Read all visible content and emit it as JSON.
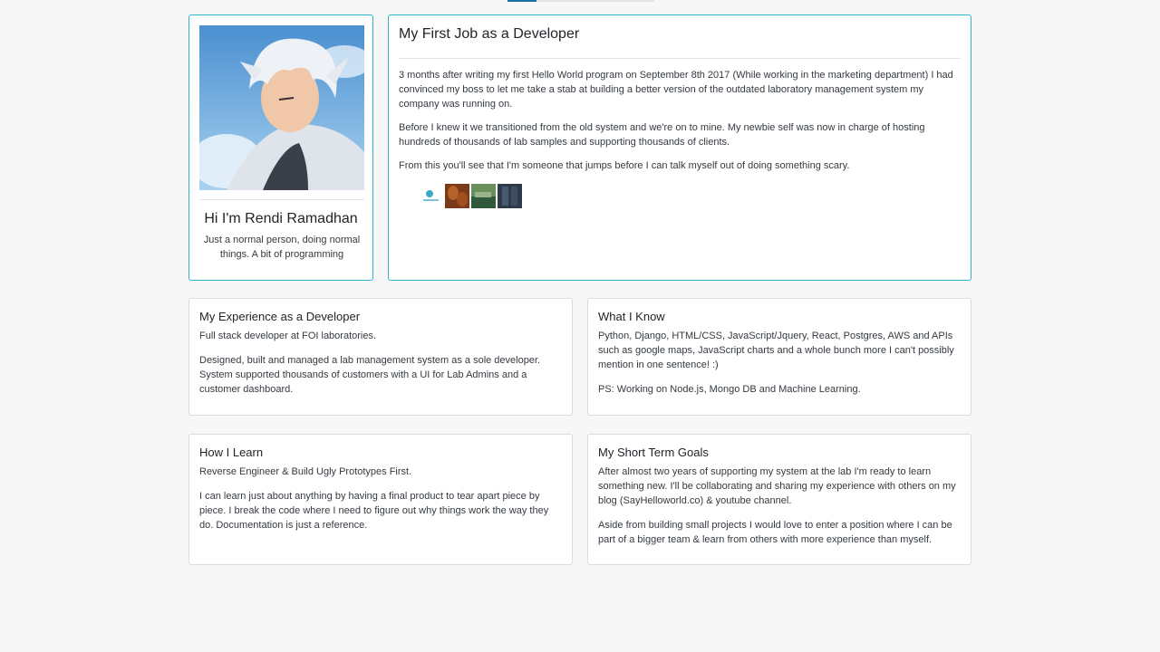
{
  "profile": {
    "name": "Hi I'm Rendi Ramadhan",
    "bio": "Just a normal person, doing normal things. A bit of programming"
  },
  "story": {
    "title": "My First Job as a Developer",
    "paragraphs": [
      "3 months after writing my first Hello World program on September 8th 2017 (While working in the marketing department) I had convinced my boss to let me take a stab at building a better version of the outdated laboratory management system my company was running on.",
      "Before I knew it we transitioned from the old system and we're on to mine. My newbie self was now in charge of hosting hundreds of thousands of lab samples and supporting thousands of clients.",
      "From this you'll see that I'm someone that jumps before I can talk myself out of doing something scary."
    ]
  },
  "experience": {
    "title": "My Experience as a Developer",
    "paragraphs": [
      "Full stack developer at FOI laboratories.",
      "Designed, built and managed a lab management system as a sole developer. System supported thousands of customers with a UI for Lab Admins and a customer dashboard."
    ]
  },
  "know": {
    "title": "What I Know",
    "paragraphs": [
      "Python, Django, HTML/CSS, JavaScript/Jquery, React, Postgres, AWS and APIs such as google maps, JavaScript charts and a whole bunch more I can't possibly mention in one sentence! :)",
      "PS: Working on Node.js, Mongo DB and Machine Learning."
    ]
  },
  "learn": {
    "title": "How I Learn",
    "paragraphs": [
      "Reverse Engineer & Build Ugly Prototypes First.",
      "I can learn just about anything by having a final product to tear apart piece by piece. I break the code where I need to figure out why things work the way they do. Documentation is just a reference."
    ]
  },
  "goals": {
    "title": "My Short Term Goals",
    "paragraphs": [
      "After almost two years of supporting my system at the lab I'm ready to learn something new. I'll be collaborating and sharing my experience with others on my blog (SayHelloworld.co) & youtube channel.",
      "Aside from building small projects I would love to enter a position where I can be part of a bigger team & learn from others with more experience than myself."
    ]
  },
  "colors": {
    "accent_border": "#2bb7c9",
    "active_tab": "#1a6fa3"
  }
}
